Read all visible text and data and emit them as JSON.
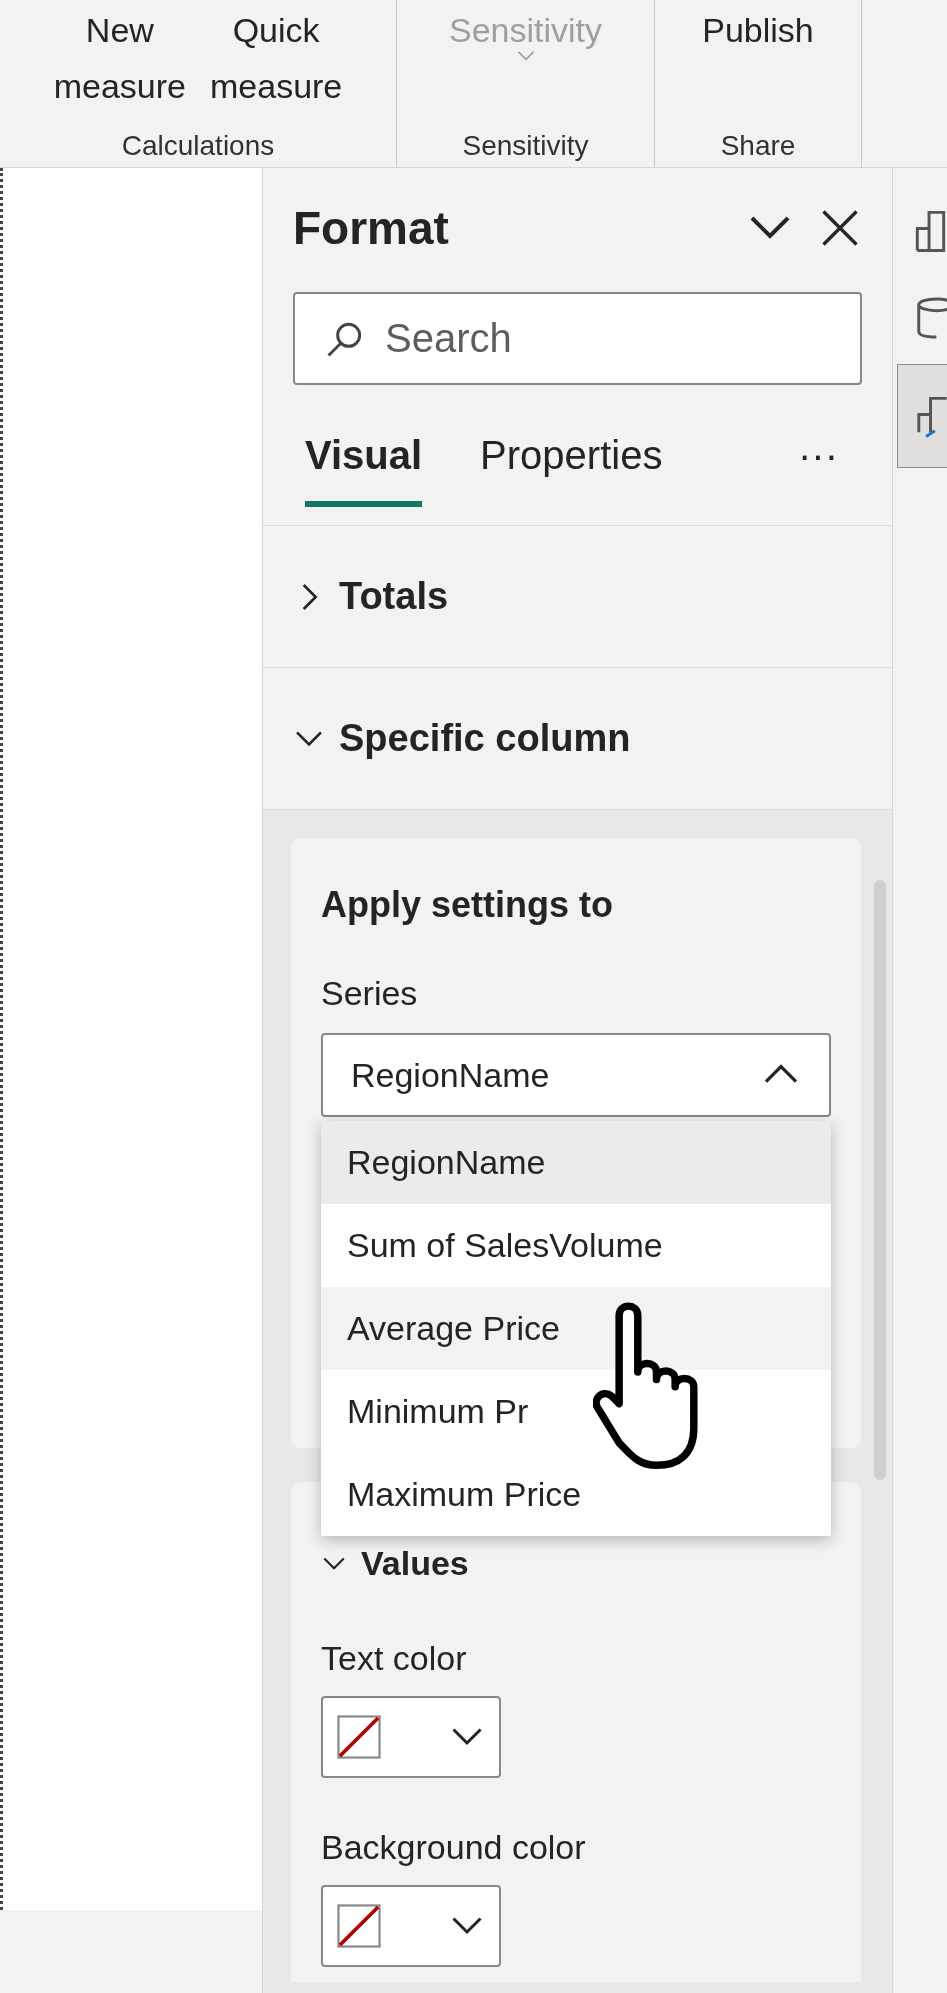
{
  "ribbon": {
    "groups": [
      {
        "label": "Calculations",
        "buttons": [
          {
            "lines": [
              "New",
              "measure"
            ],
            "disabled": false
          },
          {
            "lines": [
              "Quick",
              "measure"
            ],
            "disabled": false
          }
        ]
      },
      {
        "label": "Sensitivity",
        "buttons": [
          {
            "lines": [
              "Sensitivity"
            ],
            "disabled": true,
            "dropdown": true
          }
        ]
      },
      {
        "label": "Share",
        "buttons": [
          {
            "lines": [
              "Publish"
            ],
            "disabled": false
          }
        ]
      }
    ]
  },
  "format_pane": {
    "title": "Format",
    "search": {
      "placeholder": "Search"
    },
    "tabs": [
      {
        "label": "Visual",
        "selected": true
      },
      {
        "label": "Properties",
        "selected": false
      }
    ],
    "more": "···",
    "sections": [
      {
        "label": "Totals",
        "expanded": false
      },
      {
        "label": "Specific column",
        "expanded": true
      }
    ],
    "apply_settings": {
      "heading": "Apply settings to",
      "series_label": "Series",
      "series_value": "RegionName",
      "options": [
        {
          "label": "RegionName",
          "selected": true,
          "hovered": false
        },
        {
          "label": "Sum of SalesVolume",
          "selected": false,
          "hovered": false
        },
        {
          "label": "Average Price",
          "selected": false,
          "hovered": true
        },
        {
          "label": "Minimum Pr",
          "selected": false,
          "hovered": false
        },
        {
          "label": "Maximum Price",
          "selected": false,
          "hovered": false
        }
      ]
    },
    "values": {
      "heading": "Values",
      "expanded": true,
      "fields": [
        {
          "label": "Text color"
        },
        {
          "label": "Background color"
        }
      ]
    }
  }
}
